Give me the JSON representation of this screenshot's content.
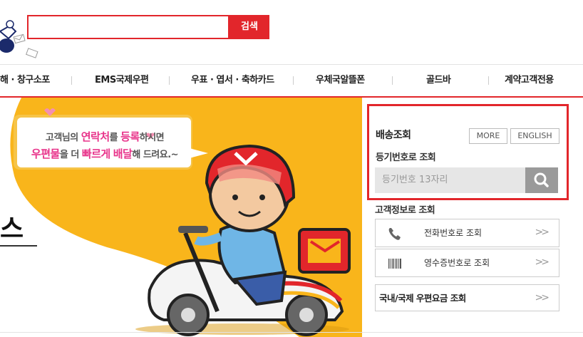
{
  "header": {
    "search_button": "검색",
    "search_value": ""
  },
  "nav": {
    "items": [
      "해 · 창구소포",
      "EMS국제우편",
      "우표 · 엽서 · 축하카드",
      "우체국알뜰폰",
      "골드바",
      "계약고객전용"
    ]
  },
  "banner": {
    "speech_line1_a": "고객님의 ",
    "speech_line1_b": "연락처",
    "speech_line1_c": "를 ",
    "speech_line1_d": "등록",
    "speech_line1_e": "하시면",
    "speech_line2_a": "우편물",
    "speech_line2_b": "을 더 ",
    "speech_line2_c": "빠르게",
    "speech_line2_d": " ",
    "speech_line2_e": "배달",
    "speech_line2_f": "해 드려요.~",
    "partial_title": "스"
  },
  "delivery": {
    "title": "배송조회",
    "more_button": "MORE",
    "english_button": "ENGLISH",
    "subtitle": "등기번호로 조회",
    "input_placeholder": "등기번호 13자리"
  },
  "customer": {
    "title": "고객정보로 조회",
    "phone_label": "전화번호로 조회",
    "receipt_label": "영수증번호로 조회",
    "rate_label": "국내/국제 우편요금 조회",
    "arrow": ">>"
  },
  "colors": {
    "accent": "#e2262b",
    "banner_yellow": "#f9b51b",
    "pink": "#e8338a"
  }
}
